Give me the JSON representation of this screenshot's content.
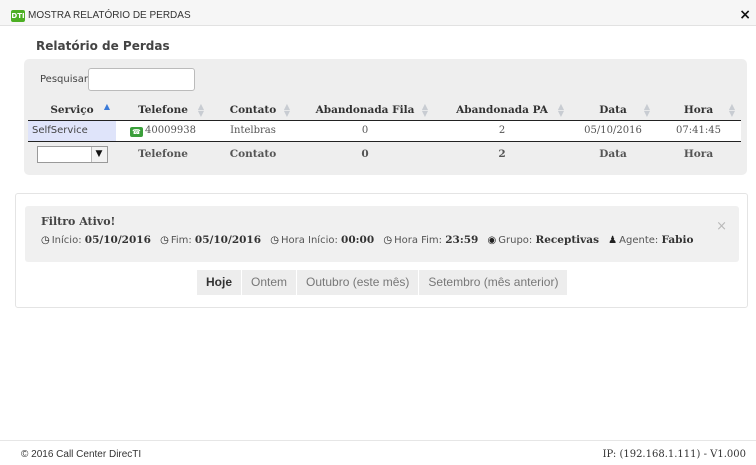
{
  "window": {
    "app_icon_text": "DTI",
    "title": "MOSTRA RELATÓRIO DE PERDAS",
    "close_label": "×"
  },
  "page": {
    "heading": "Relatório de Perdas"
  },
  "search": {
    "label": "Pesquisar:",
    "value": "",
    "placeholder": ""
  },
  "table": {
    "columns": [
      "Serviço",
      "Telefone",
      "Contato",
      "Abandonada Fila",
      "Abandonada PA",
      "Data",
      "Hora"
    ],
    "rows": [
      {
        "servico": "SelfService",
        "telefone": "40009938",
        "contato": "Intelbras",
        "abandonada_fila": "0",
        "abandonada_pa": "2",
        "data": "05/10/2016",
        "hora": "07:41:45"
      }
    ],
    "footer": {
      "servico_filter": "",
      "telefone": "Telefone",
      "contato": "Contato",
      "abandonada_fila": "0",
      "abandonada_pa": "2",
      "data": "Data",
      "hora": "Hora"
    }
  },
  "filter": {
    "title": "Filtro Ativo!",
    "inicio_label": "Início:",
    "inicio_value": "05/10/2016",
    "fim_label": "Fim:",
    "fim_value": "05/10/2016",
    "hora_inicio_label": "Hora Início:",
    "hora_inicio_value": "00:00",
    "hora_fim_label": "Hora Fim:",
    "hora_fim_value": "23:59",
    "grupo_label": "Grupo:",
    "grupo_value": "Receptivas",
    "agente_label": "Agente:",
    "agente_value": "Fabio",
    "close_label": "×"
  },
  "date_buttons": [
    {
      "label": "Hoje",
      "active": true
    },
    {
      "label": "Ontem",
      "active": false
    },
    {
      "label": "Outubro (este mês)",
      "active": false
    },
    {
      "label": "Setembro (mês anterior)",
      "active": false
    }
  ],
  "footer": {
    "copyright": "© 2016 Call Center DirecTI",
    "ip": "IP: (192.168.1.111) - V1.000"
  },
  "icons": {
    "clock": "clock-icon",
    "globe": "globe-icon",
    "user": "user-icon",
    "phone": "phone-icon",
    "sort": "sort-icon"
  },
  "colors": {
    "selected_cell": "#dfe4fa",
    "panel_bg": "#eeeeee",
    "app_icon": "#4caf23",
    "phone_icon": "#3a9f3a",
    "sort_active": "#3a7ad8"
  }
}
